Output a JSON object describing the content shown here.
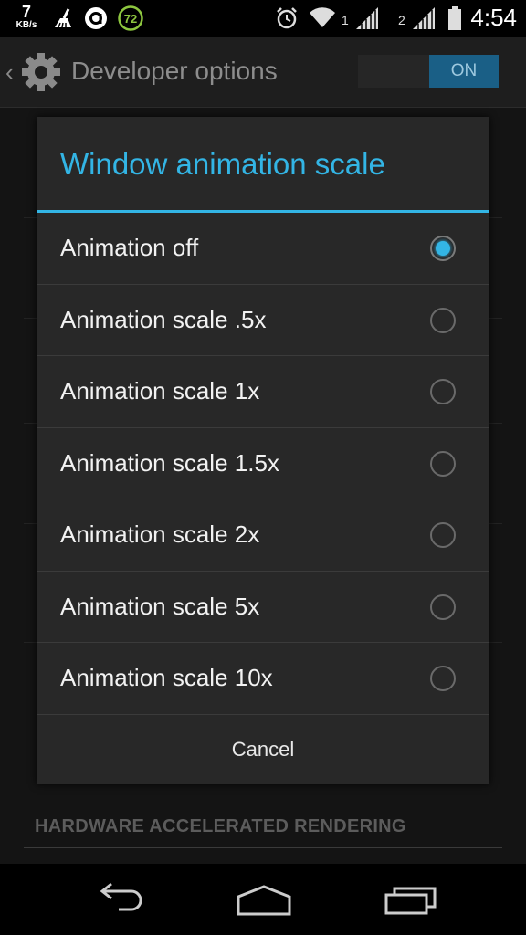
{
  "status_bar": {
    "speed_value": "7",
    "speed_unit": "KB/s",
    "badge_number": "72",
    "sim1_label": "1",
    "sim2_label": "2",
    "clock": "4:54"
  },
  "action_bar": {
    "title": "Developer options",
    "toggle_label": "ON"
  },
  "background": {
    "section_header": "HARDWARE ACCELERATED RENDERING"
  },
  "dialog": {
    "title": "Window animation scale",
    "options": [
      {
        "label": "Animation off",
        "selected": true
      },
      {
        "label": "Animation scale .5x",
        "selected": false
      },
      {
        "label": "Animation scale 1x",
        "selected": false
      },
      {
        "label": "Animation scale 1.5x",
        "selected": false
      },
      {
        "label": "Animation scale 2x",
        "selected": false
      },
      {
        "label": "Animation scale 5x",
        "selected": false
      },
      {
        "label": "Animation scale 10x",
        "selected": false
      }
    ],
    "cancel_label": "Cancel"
  },
  "colors": {
    "accent": "#33b5e5",
    "dialog_bg": "#282828",
    "toggle_on": "#1a5f86"
  },
  "icons": [
    "broom-icon",
    "circle-a-icon",
    "battery-saver-72-icon",
    "alarm-icon",
    "wifi-icon",
    "signal-icon",
    "battery-icon",
    "back-chevron-icon",
    "gear-icon",
    "nav-back-icon",
    "nav-home-icon",
    "nav-recents-icon"
  ]
}
